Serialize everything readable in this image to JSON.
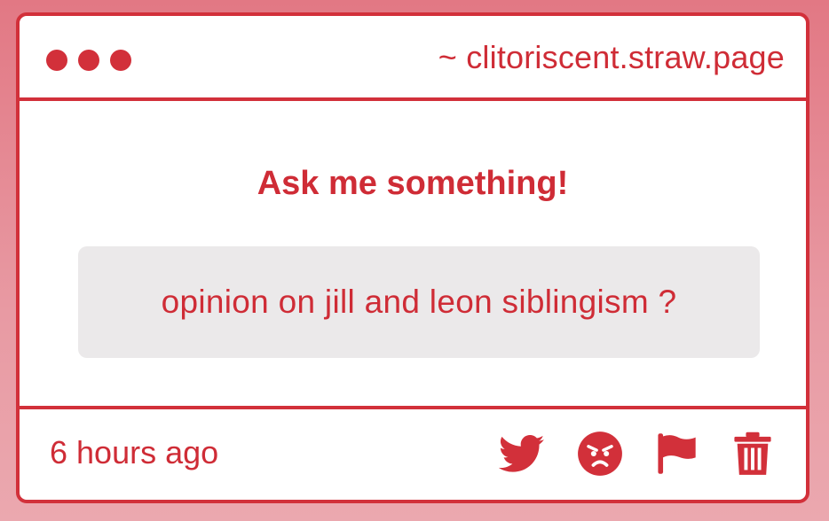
{
  "window": {
    "url": "~ clitoriscent.straw.page"
  },
  "main": {
    "heading": "Ask me something!",
    "question": "opinion on jill and leon siblingism ?"
  },
  "footer": {
    "timestamp": "6 hours ago",
    "actions": [
      {
        "icon": "twitter-icon"
      },
      {
        "icon": "angry-face-icon"
      },
      {
        "icon": "flag-icon"
      },
      {
        "icon": "trash-icon"
      }
    ]
  },
  "colors": {
    "accent": "#d2303a",
    "text": "#cf2c36",
    "question_bg": "#ebe9ea",
    "page_bg": "#e6848f"
  }
}
